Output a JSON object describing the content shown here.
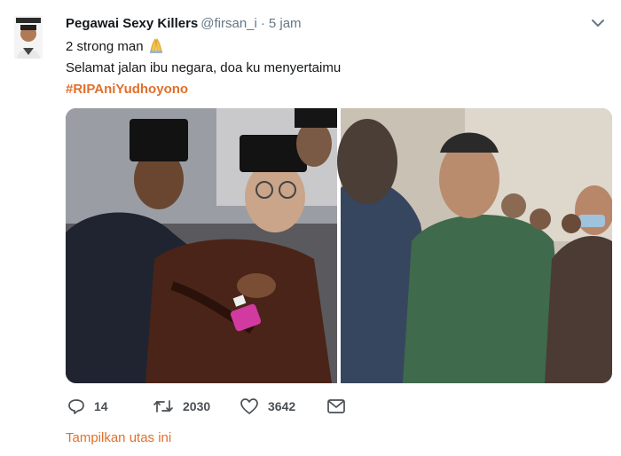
{
  "tweet": {
    "author_name": "Pegawai Sexy Killers",
    "handle": "@firsan_i",
    "separator": "·",
    "time": "5 jam",
    "line1": "2 strong man",
    "line2": "Selamat jalan ibu negara, doa ku menyertaimu",
    "hashtag": "#RIPAniYudhoyono",
    "reply_count": "14",
    "retweet_count": "2030",
    "like_count": "3642",
    "show_thread": "Tampilkan utas ini"
  },
  "icons": {
    "caret": "chevron-down-icon",
    "emoji": "folded-hands-icon",
    "reply": "reply-icon",
    "retweet": "retweet-icon",
    "like": "heart-icon",
    "dm": "envelope-icon"
  },
  "colors": {
    "accent": "#e0702d",
    "text": "#14171a",
    "muted": "#657786"
  }
}
